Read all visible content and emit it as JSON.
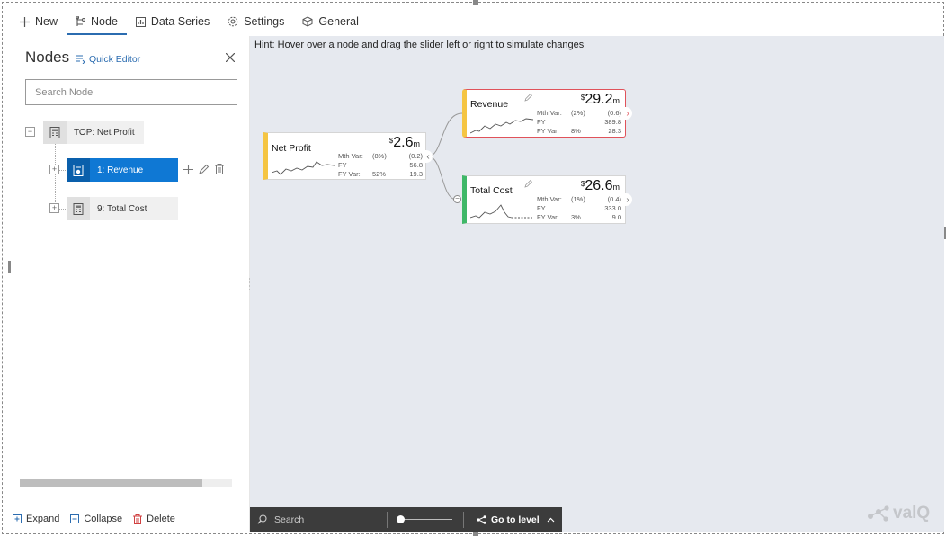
{
  "toolbar": {
    "items": [
      {
        "label": "New",
        "icon": "plus-icon"
      },
      {
        "label": "Node",
        "icon": "node-tree-icon"
      },
      {
        "label": "Data Series",
        "icon": "data-series-icon"
      },
      {
        "label": "Settings",
        "icon": "gear-icon"
      },
      {
        "label": "General",
        "icon": "cube-icon"
      }
    ],
    "active": "Node"
  },
  "panel": {
    "title": "Nodes",
    "quick_editor": "Quick Editor",
    "search_placeholder": "Search Node",
    "tree": [
      {
        "label": "TOP: Net Profit",
        "expander": "−"
      },
      {
        "label": "1: Revenue",
        "expander": "+",
        "selected": true
      },
      {
        "label": "9: Total Cost",
        "expander": "+"
      }
    ],
    "scroll_fraction": 0.86,
    "footer": {
      "expand": "Expand",
      "collapse": "Collapse",
      "delete": "Delete"
    }
  },
  "canvas": {
    "hint": "Hint: Hover over a node and drag the slider left or right to simulate changes",
    "cards": {
      "net_profit": {
        "title": "Net Profit",
        "currency": "$",
        "value": "2.6",
        "unit": "m",
        "mth_var_label": "Mth Var:",
        "mth_var_pct": "(8%)",
        "mth_var_val": "(0.2)",
        "fy_label": "FY",
        "fy_val": "56.8",
        "fy_var_label": "FY Var:",
        "fy_var_pct": "52%",
        "fy_var_val": "19.3",
        "accent": "#f5c542"
      },
      "revenue": {
        "title": "Revenue",
        "currency": "$",
        "value": "29.2",
        "unit": "m",
        "mth_var_label": "Mth Var:",
        "mth_var_pct": "(2%)",
        "mth_var_val": "(0.6)",
        "fy_label": "FY",
        "fy_val": "389.8",
        "fy_var_label": "FY Var:",
        "fy_var_pct": "8%",
        "fy_var_val": "28.3",
        "accent": "#f5c542",
        "highlight": "#e0525a"
      },
      "total_cost": {
        "title": "Total Cost",
        "currency": "$",
        "value": "26.6",
        "unit": "m",
        "mth_var_label": "Mth Var:",
        "mth_var_pct": "(1%)",
        "mth_var_val": "(0.4)",
        "fy_label": "FY",
        "fy_val": "333.0",
        "fy_var_label": "FY Var:",
        "fy_var_pct": "3%",
        "fy_var_val": "9.0",
        "accent": "#3fb868"
      }
    },
    "bottom_bar": {
      "search_placeholder": "Search",
      "go_to_level": "Go to level"
    },
    "logo_text": "valQ"
  },
  "colors": {
    "accent_blue": "#0f78d4",
    "canvas_bg": "#e6e9ef",
    "bar_bg": "#3c3c3c"
  }
}
